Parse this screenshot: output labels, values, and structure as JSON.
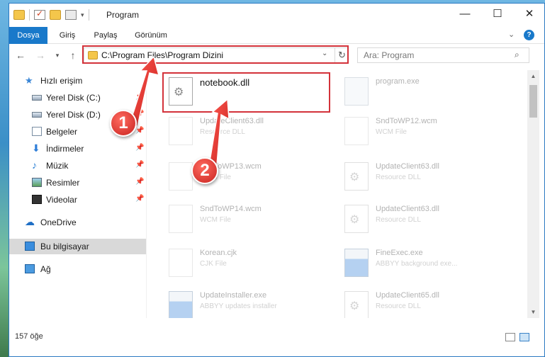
{
  "window": {
    "title": "Program",
    "controls": {
      "minimize": "—",
      "maximize": "☐",
      "close": "✕"
    }
  },
  "ribbon": {
    "tabs": [
      "Dosya",
      "Giriş",
      "Paylaş",
      "Görünüm"
    ],
    "help": "?"
  },
  "nav": {
    "address": "C:\\Program Files\\Program Dizini",
    "search_placeholder": "Ara: Program"
  },
  "sidebar": {
    "items": [
      {
        "label": "Hızlı erişim",
        "icon": "star-icon"
      },
      {
        "label": "Yerel Disk (C:)",
        "icon": "disk-icon",
        "pinned": true
      },
      {
        "label": "Yerel Disk (D:)",
        "icon": "disk-icon",
        "pinned": true
      },
      {
        "label": "Belgeler",
        "icon": "documents-icon",
        "pinned": true
      },
      {
        "label": "İndirmeler",
        "icon": "downloads-icon",
        "pinned": true
      },
      {
        "label": "Müzik",
        "icon": "music-icon",
        "pinned": true
      },
      {
        "label": "Resimler",
        "icon": "pictures-icon",
        "pinned": true
      },
      {
        "label": "Videolar",
        "icon": "videos-icon",
        "pinned": true
      },
      {
        "label": "OneDrive",
        "icon": "onedrive-icon"
      },
      {
        "label": "Bu bilgisayar",
        "icon": "computer-icon",
        "selected": true
      },
      {
        "label": "Ağ",
        "icon": "network-icon"
      }
    ]
  },
  "files": {
    "items": [
      {
        "name": "notebook.dll",
        "type": "",
        "icon": "dll-icon",
        "highlighted": true
      },
      {
        "name": "program.exe",
        "type": "",
        "icon": "exe-icon"
      },
      {
        "name": "UpdateClient63.dll",
        "type": "Resource DLL",
        "icon": "file-icon"
      },
      {
        "name": "SndToWP12.wcm",
        "type": "WCM File",
        "icon": "file-icon"
      },
      {
        "name": "SndToWP13.wcm",
        "type": "WCM File",
        "icon": "file-icon"
      },
      {
        "name": "UpdateClient63.dll",
        "type": "Resource DLL",
        "icon": "dll-icon"
      },
      {
        "name": "SndToWP14.wcm",
        "type": "WCM File",
        "icon": "file-icon"
      },
      {
        "name": "UpdateClient63.dll",
        "type": "Resource DLL",
        "icon": "dll-icon"
      },
      {
        "name": "Korean.cjk",
        "type": "CJK File",
        "icon": "file-icon"
      },
      {
        "name": "FineExec.exe",
        "type": "ABBYY background exe...",
        "icon": "exe-icon"
      },
      {
        "name": "UpdateInstaller.exe",
        "type": "ABBYY updates installer",
        "icon": "exe-icon"
      },
      {
        "name": "UpdateClient65.dll",
        "type": "Resource DLL",
        "icon": "dll-icon"
      }
    ]
  },
  "status": {
    "count": "157 öğe"
  },
  "annotations": {
    "step1": "1",
    "step2": "2",
    "color": "#d3323a"
  }
}
